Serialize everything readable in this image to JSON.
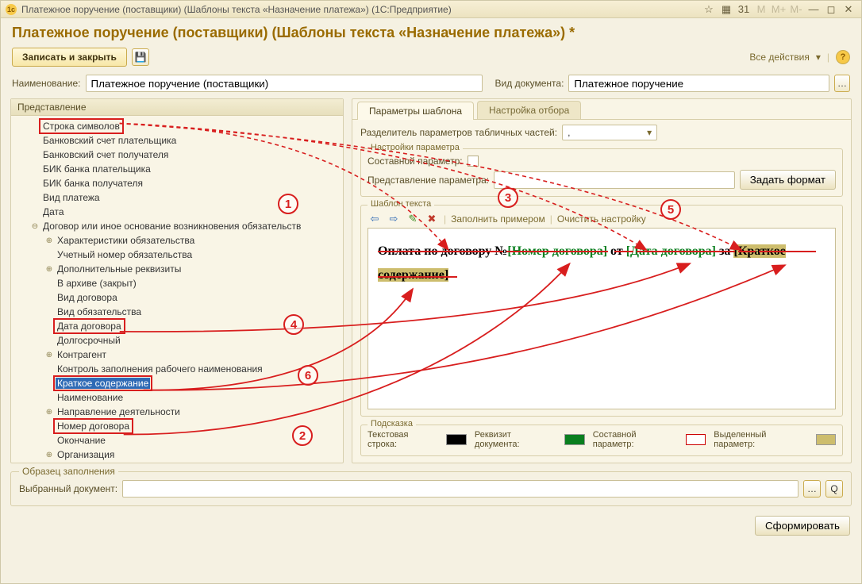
{
  "titlebar": {
    "text": "Платежное поручение (поставщики) (Шаблоны текста «Назначение платежа»)  (1С:Предприятие)"
  },
  "header": {
    "title": "Платежное поручение (поставщики) (Шаблоны текста «Назначение платежа») *"
  },
  "toolbar": {
    "write_close": "Записать и закрыть",
    "all_actions": "Все действия"
  },
  "fields": {
    "name_label": "Наименование:",
    "name_value": "Платежное поручение (поставщики)",
    "doc_type_label": "Вид документа:",
    "doc_type_value": "Платежное поручение"
  },
  "left_panel": {
    "title": "Представление",
    "tree": [
      {
        "label": "Строка символов",
        "level": 1,
        "exp": "",
        "red": true
      },
      {
        "label": "Банковский счет плательщика",
        "level": 1,
        "exp": ""
      },
      {
        "label": "Банковский счет получателя",
        "level": 1,
        "exp": ""
      },
      {
        "label": "БИК банка плательщика",
        "level": 1,
        "exp": ""
      },
      {
        "label": "БИК банка получателя",
        "level": 1,
        "exp": ""
      },
      {
        "label": "Вид платежа",
        "level": 1,
        "exp": ""
      },
      {
        "label": "Дата",
        "level": 1,
        "exp": ""
      },
      {
        "label": "Договор или иное основание возникновения обязательств",
        "level": 1,
        "exp": "⊖"
      },
      {
        "label": "Характеристики обязательства",
        "level": 2,
        "exp": "⊕"
      },
      {
        "label": "Учетный номер обязательства",
        "level": 2,
        "exp": ""
      },
      {
        "label": "Дополнительные реквизиты",
        "level": 2,
        "exp": "⊕"
      },
      {
        "label": "В архиве (закрыт)",
        "level": 2,
        "exp": ""
      },
      {
        "label": "Вид договора",
        "level": 2,
        "exp": ""
      },
      {
        "label": "Вид обязательства",
        "level": 2,
        "exp": ""
      },
      {
        "label": "Дата договора",
        "level": 2,
        "exp": "",
        "red": true
      },
      {
        "label": "Долгосрочный",
        "level": 2,
        "exp": ""
      },
      {
        "label": "Контрагент",
        "level": 2,
        "exp": "⊕"
      },
      {
        "label": "Контроль заполнения рабочего наименования",
        "level": 2,
        "exp": ""
      },
      {
        "label": "Краткое содержание",
        "level": 2,
        "exp": "",
        "red": true,
        "sel": true
      },
      {
        "label": "Наименование",
        "level": 2,
        "exp": ""
      },
      {
        "label": "Направление деятельности",
        "level": 2,
        "exp": "⊕"
      },
      {
        "label": "Номер договора",
        "level": 2,
        "exp": "",
        "red": true
      },
      {
        "label": "Окончание",
        "level": 2,
        "exp": ""
      },
      {
        "label": "Организация",
        "level": 2,
        "exp": "⊕"
      }
    ]
  },
  "tabs": {
    "t1": "Параметры шаблона",
    "t2": "Настройка отбора"
  },
  "right": {
    "split_label": "Разделитель параметров табличных частей:",
    "split_value": ",",
    "param_settings_legend": "Настройки параметра",
    "compound_label": "Составной параметр:",
    "repr_label": "Представление параметра:",
    "format_btn": "Задать формат",
    "template_legend": "Шаблон текста",
    "fill_example": "Заполнить примером",
    "clear_settings": "Очистить настройку",
    "template_parts": {
      "t1": "Оплата по договору №",
      "p1": "[Номер договора]",
      "t2": " от ",
      "p2": "[Дата договора]",
      "t3": " за ",
      "p3_a": "[Краткое",
      "p3_b": "содержание]"
    },
    "hint_legend": "Подсказка",
    "hints": {
      "h1": "Текстовая строка:",
      "h2": "Реквизит документа:",
      "h3": "Составной параметр:",
      "h4": "Выделенный параметр:"
    }
  },
  "bottom": {
    "legend": "Образец заполнения",
    "sel_doc_label": "Выбранный документ:",
    "form_btn": "Сформировать"
  },
  "badges": {
    "b1": "1",
    "b2": "2",
    "b3": "3",
    "b4": "4",
    "b5": "5",
    "b6": "6"
  }
}
